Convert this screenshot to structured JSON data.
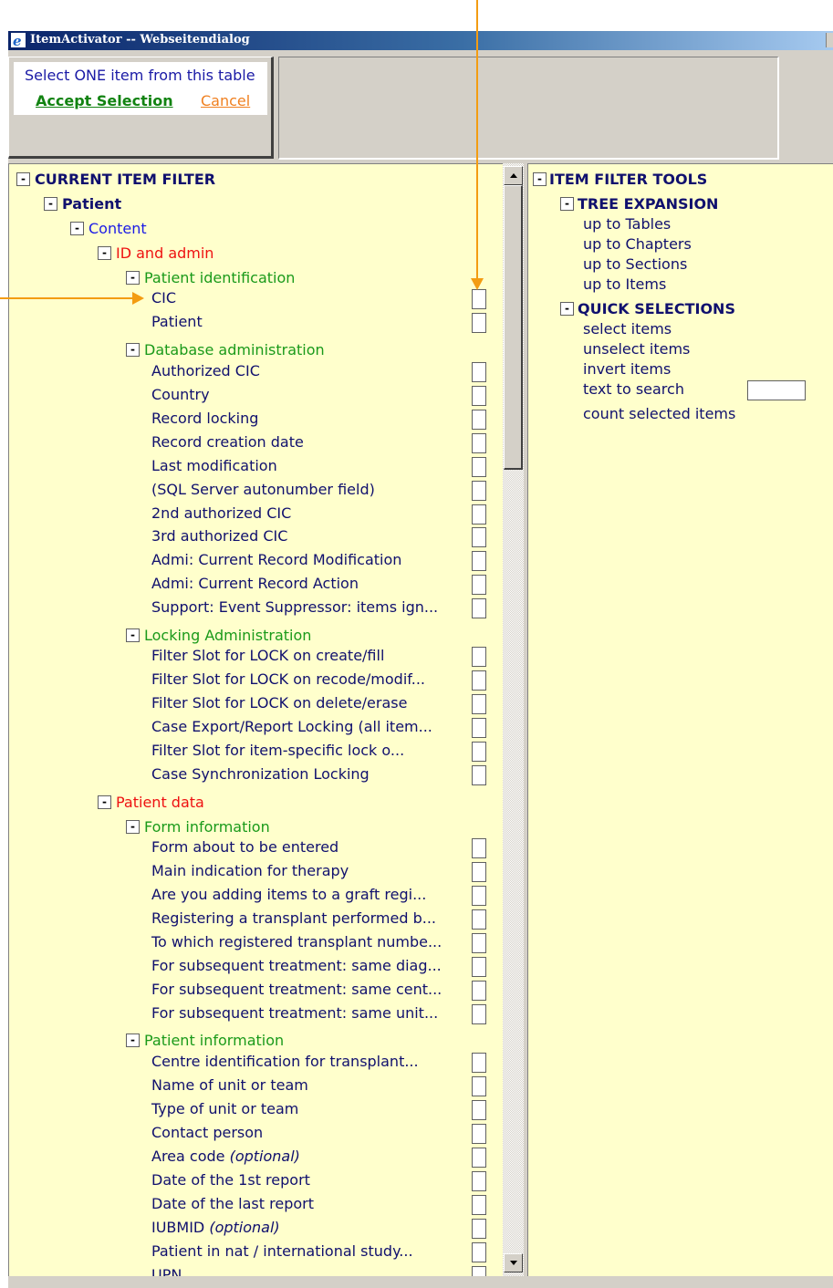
{
  "window": {
    "title": "ItemActivator -- Webseitendialog"
  },
  "toolbar": {
    "prompt": "Select ONE item from this table",
    "accept_label": "Accept Selection",
    "cancel_label": "Cancel"
  },
  "tree": {
    "root": "CURRENT ITEM FILTER",
    "patient": "Patient",
    "content": "Content",
    "id_admin": "ID and admin",
    "patient_identification": "Patient identification",
    "pid_items": [
      "CIC",
      "Patient"
    ],
    "database_administration": "Database administration",
    "db_items": [
      "Authorized CIC",
      "Country",
      "Record locking",
      "Record creation date",
      "Last modification",
      "(SQL Server autonumber field)",
      "2nd authorized CIC",
      "3rd authorized CIC",
      "Admi: Current Record Modification",
      "Admi: Current Record Action",
      "Support: Event Suppressor: items ign..."
    ],
    "locking_administration": "Locking Administration",
    "lock_items": [
      "Filter Slot for LOCK on create/fill",
      "Filter Slot for LOCK on recode/modif...",
      "Filter Slot for LOCK on delete/erase",
      "Case Export/Report Locking (all item...",
      "Filter Slot for item-specific lock o...",
      "Case Synchronization Locking"
    ],
    "patient_data": "Patient data",
    "form_information": "Form information",
    "form_items": [
      "Form about to be entered",
      "Main indication for therapy",
      "Are you adding items to a graft regi...",
      "Registering a transplant performed b...",
      "To which registered transplant numbe...",
      "For  subsequent treatment: same diag...",
      "For  subsequent treatment: same cent...",
      "For  subsequent treatment: same unit..."
    ],
    "patient_information": "Patient information",
    "pinfo_items": [
      "Centre identification for transplant...",
      "Name of unit or team",
      "Type of unit or team",
      "Contact person",
      "Area code",
      "Date of the 1st report",
      "Date of the last report",
      "IUBMID",
      "Patient in nat / international study...",
      "UPN"
    ],
    "optional_suffix": "(optional)"
  },
  "tools": {
    "root": "ITEM FILTER TOOLS",
    "tree_expansion": "TREE EXPANSION",
    "expansion_items": [
      "up to Tables",
      "up to Chapters",
      "up to Sections",
      "up to Items"
    ],
    "quick_selections": "QUICK SELECTIONS",
    "quick_items": [
      "select items",
      "unselect items",
      "invert items",
      "text to search",
      "count selected items"
    ]
  },
  "toggle_glyph": "-",
  "colors": {
    "pane_bg": "#ffffcc",
    "arrow": "#f39c12",
    "title_bar": "#0a246a"
  }
}
